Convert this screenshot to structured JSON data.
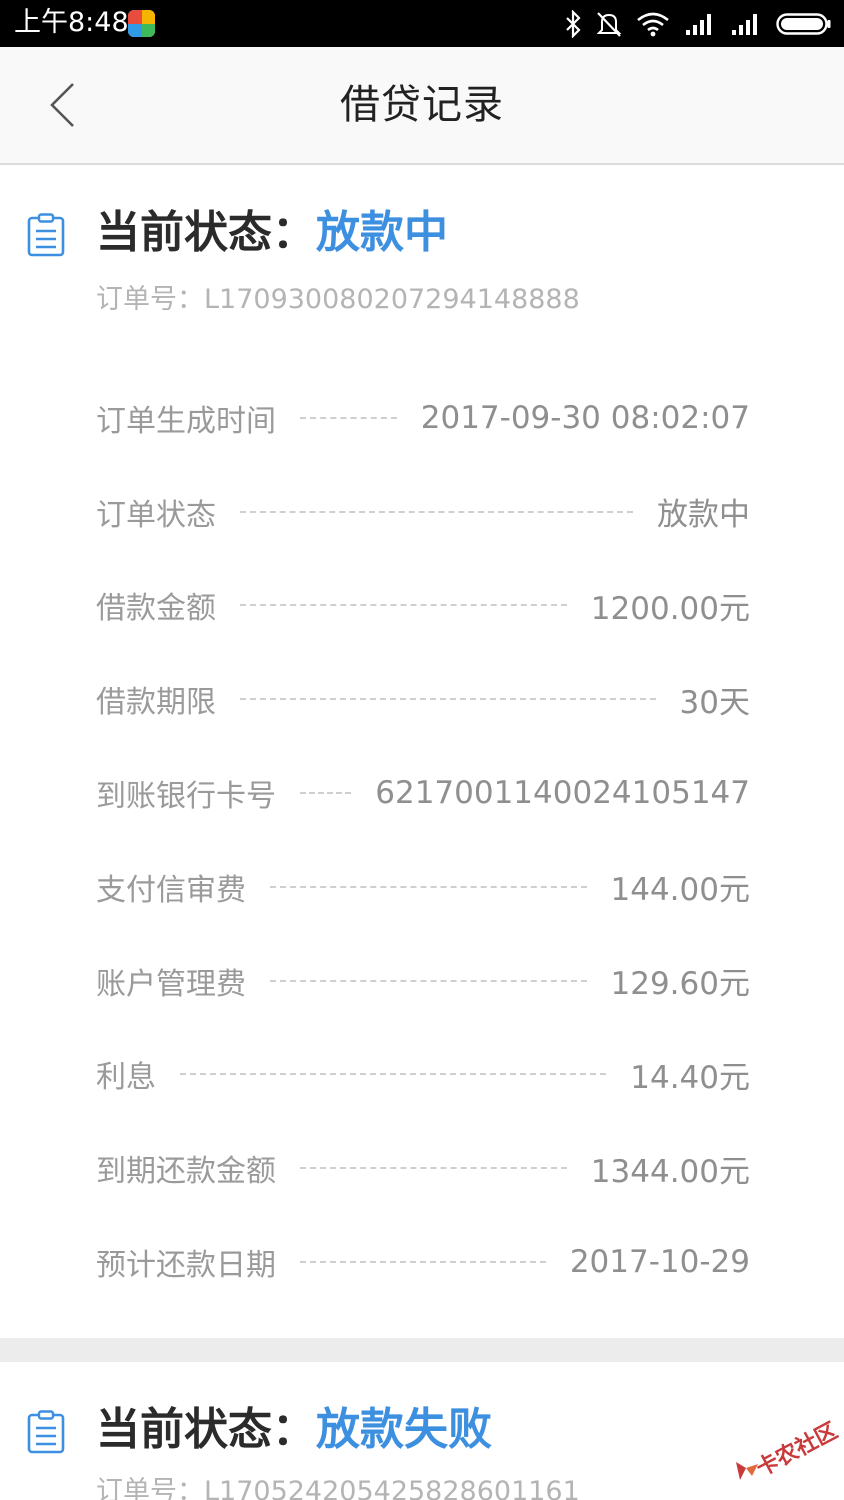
{
  "status_bar": {
    "time": "上午8:48",
    "icons": [
      "bluetooth-icon",
      "bell-muted-icon",
      "wifi-icon",
      "signal-icon",
      "signal-icon",
      "battery-icon"
    ]
  },
  "nav": {
    "back_icon": "chevron-left-icon",
    "title": "借贷记录"
  },
  "colors": {
    "accent": "#3d8fe0",
    "label_gray": "#9a9a9a",
    "watermark": "#c93a3a"
  },
  "records": [
    {
      "status_label": "当前状态：",
      "status_value": "放款中",
      "order_no": "订单号：L17093008020729414888​8",
      "details": [
        {
          "label": "订单生成时间",
          "value": "2017-09-30 08:02:07"
        },
        {
          "label": "订单状态",
          "value": "放款中"
        },
        {
          "label": "借款金额",
          "value": "1200.00元"
        },
        {
          "label": "借款期限",
          "value": "30天"
        },
        {
          "label": "到账银行卡号",
          "value": "6217001140024105147"
        },
        {
          "label": "支付信审费",
          "value": "144.00元"
        },
        {
          "label": "账户管理费",
          "value": "129.60元"
        },
        {
          "label": "利息",
          "value": "14.40元"
        },
        {
          "label": "到期还款金额",
          "value": "1344.00元"
        },
        {
          "label": "预计还款日期",
          "value": "2017-10-29"
        }
      ]
    },
    {
      "status_label": "当前状态：",
      "status_value": "放款失败",
      "order_no": "订单号：L1705242054258286011​61"
    }
  ],
  "watermark": {
    "text": "卡农社区"
  }
}
